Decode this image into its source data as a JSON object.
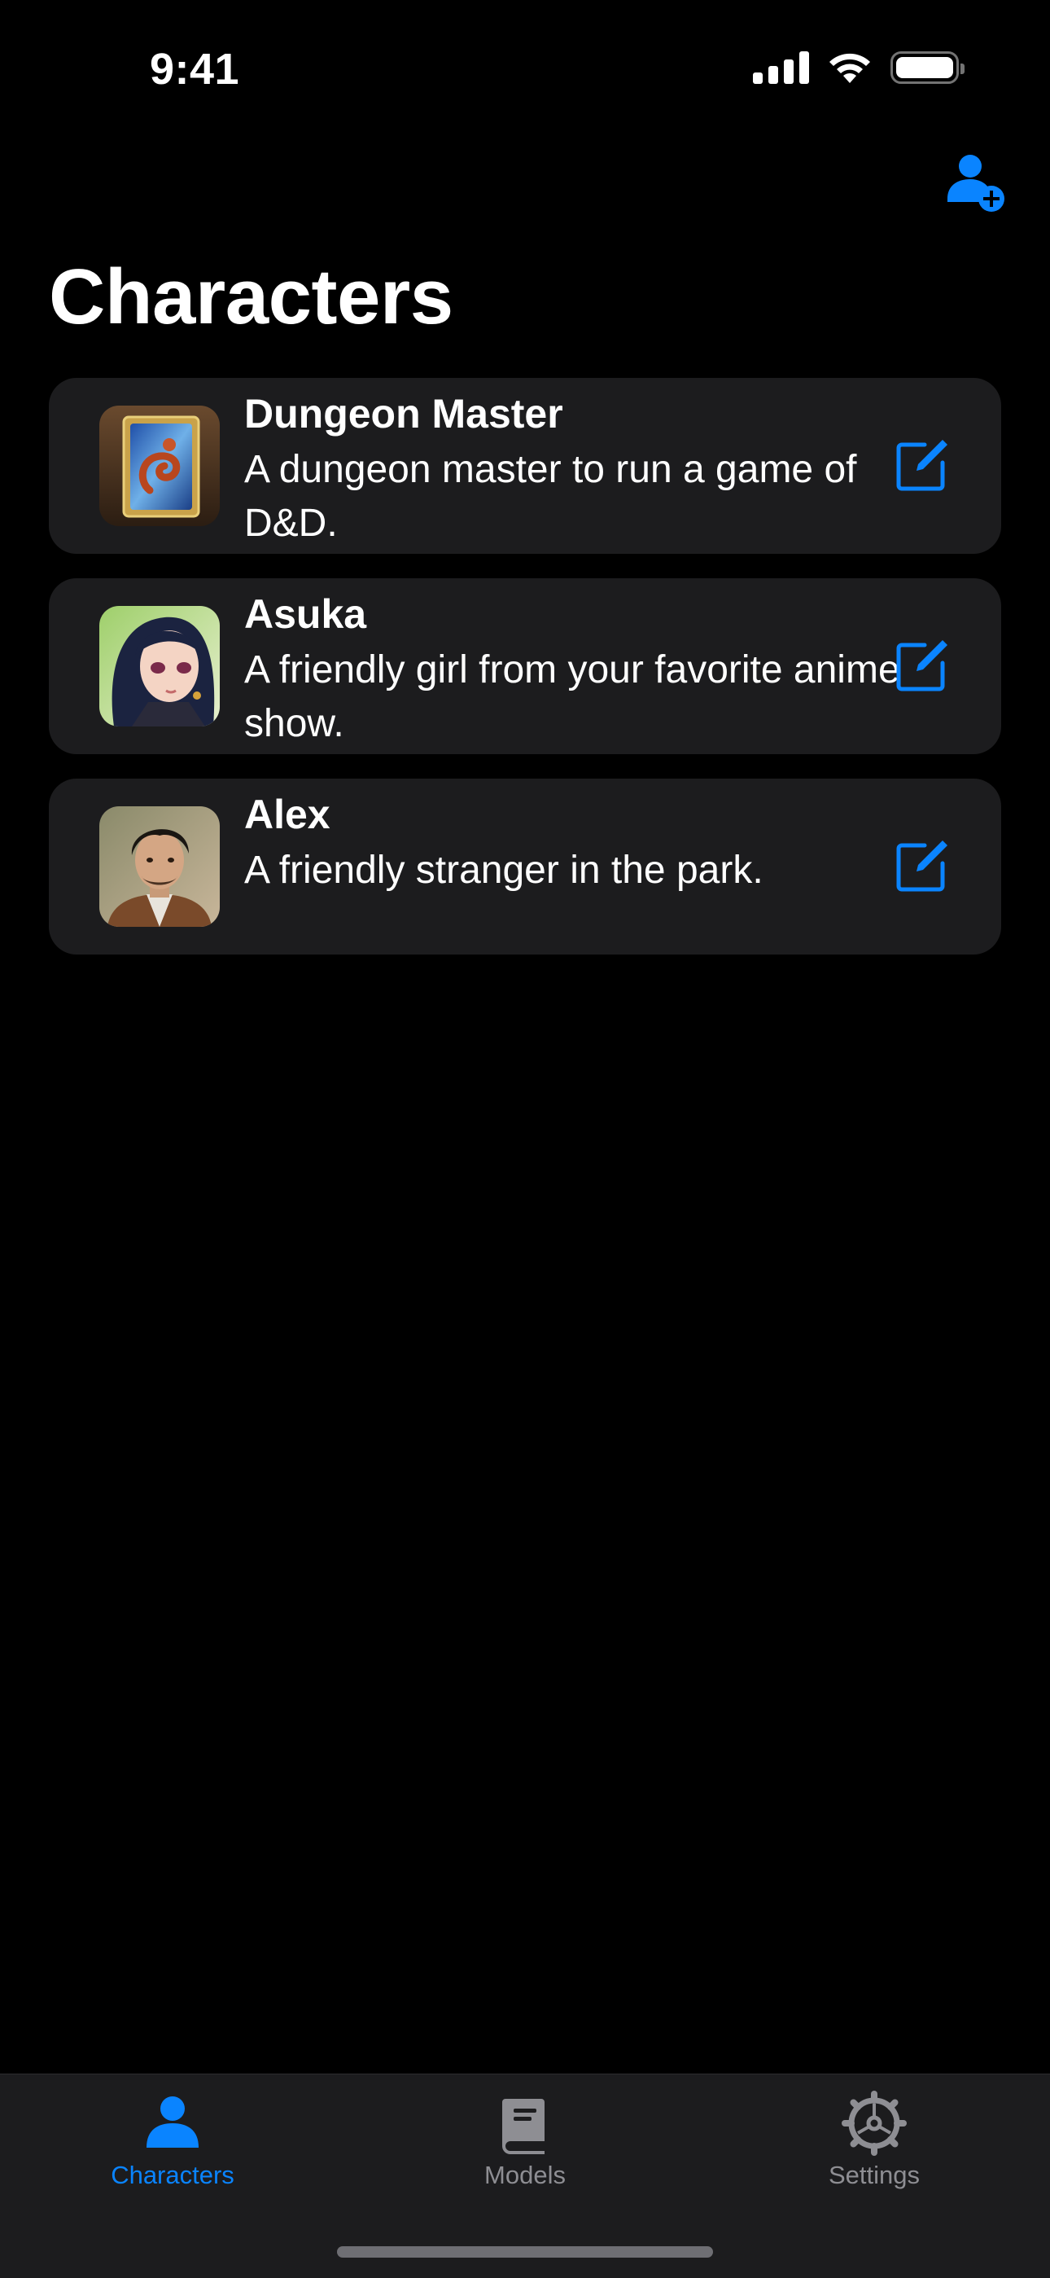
{
  "status_bar": {
    "time": "9:41"
  },
  "header": {
    "title": "Characters",
    "add_icon": "person-add-icon"
  },
  "characters": [
    {
      "name": "Dungeon Master",
      "description": "A dungeon master to run a game of D&D.",
      "avatar": "dragon-book-avatar"
    },
    {
      "name": "Asuka",
      "description": "A friendly girl from your favorite anime show.",
      "avatar": "anime-girl-avatar"
    },
    {
      "name": "Alex",
      "description": "A friendly stranger in the park.",
      "avatar": "man-portrait-avatar"
    }
  ],
  "tabs": [
    {
      "label": "Characters",
      "icon": "person-icon",
      "active": true
    },
    {
      "label": "Models",
      "icon": "book-icon",
      "active": false
    },
    {
      "label": "Settings",
      "icon": "gear-icon",
      "active": false
    }
  ],
  "colors": {
    "accent": "#0a84ff",
    "card": "#1c1c1e",
    "inactive": "#8e8e93"
  }
}
